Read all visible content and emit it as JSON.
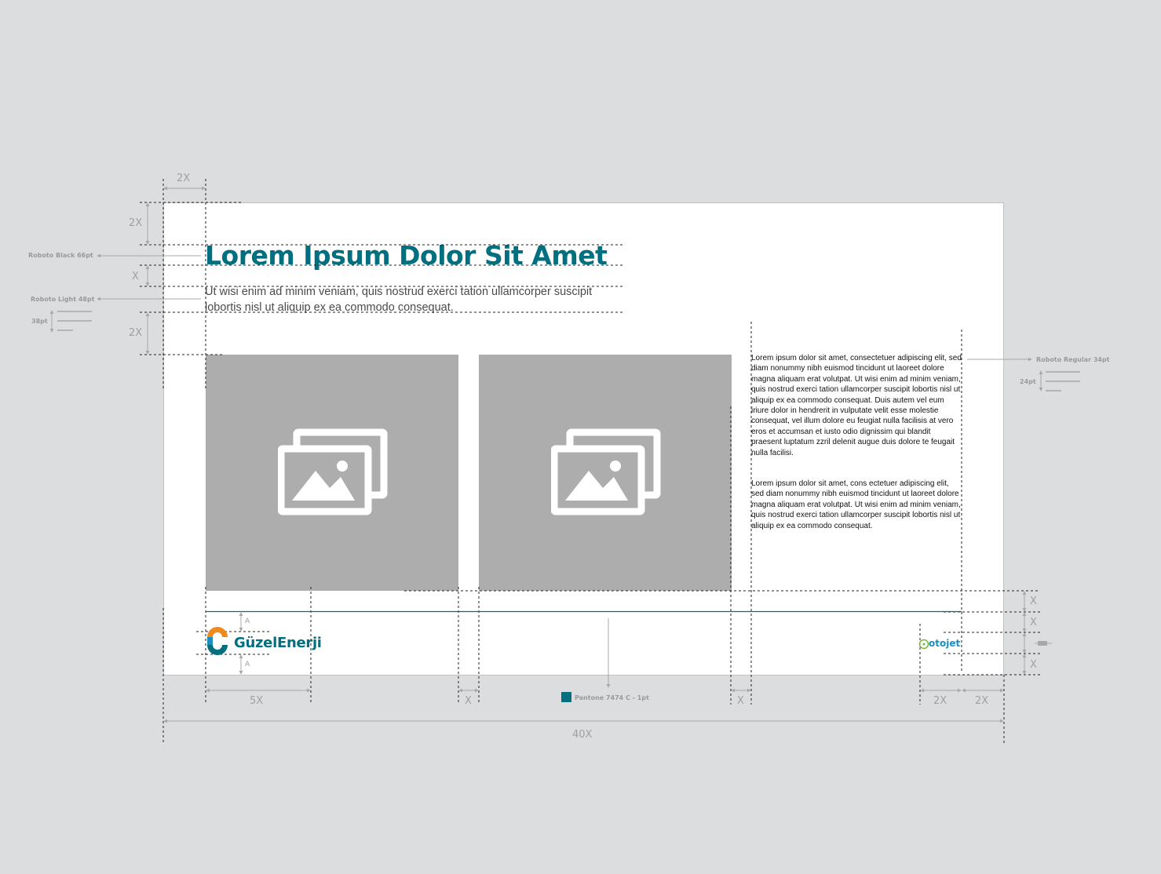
{
  "colors": {
    "brand": "#006f7f",
    "placeholder": "#adadad",
    "dimension": "#a0a0a0",
    "canvas": "#dcdddf",
    "otojet_green": "#7bb53b",
    "otojet_blue": "#1b8fc0",
    "guzel_orange": "#f08a1c"
  },
  "headline": "Lorem Ipsum Dolor Sit Amet",
  "subtitle": "Ut wisi enim ad minim veniam, quis nostrud exerci tation ullamcorper suscipit lobortis nisl ut aliquip ex ea commodo consequat.",
  "body_paragraphs": [
    "Lorem ipsum dolor sit amet, consectetuer adipiscing elit, sed diam nonummy nibh euismod tincidunt ut laoreet dolore magna aliquam erat volutpat. Ut wisi enim ad minim veniam, quis nostrud exerci tation ullamcorper suscipit lobortis nisl ut aliquip ex ea commodo consequat. Duis autem vel eum iriure dolor in hendrerit in vulputate velit esse molestie consequat, vel illum dolore eu feugiat nulla facilisis at vero eros et accumsan et iusto odio dignissim qui blandit praesent luptatum zzril delenit augue duis dolore te feugait nulla facilisi.",
    "Lorem ipsum dolor sit amet, cons ectetuer adipiscing elit, sed diam nonummy nibh euismod tincidunt ut laoreet dolore magna aliquam erat volutpat. Ut wisi enim ad minim veniam, quis nostrud exerci tation ullamcorper suscipit lobortis nisl ut aliquip ex ea commodo consequat."
  ],
  "annotations": {
    "headline_font": "Roboto Black 66pt",
    "subtitle_font": "Roboto Light 48pt",
    "subtitle_leading": "38pt",
    "body_font": "Roboto Regular 34pt",
    "body_leading": "24pt",
    "pantone": "Pantone 7474 C - 1pt"
  },
  "dimensions": {
    "top_left_width": "2X",
    "top_margin": "2X",
    "title_gap": "X",
    "subtitle_gap": "2X",
    "logo_width": "5X",
    "gutter_a": "X",
    "gutter_b": "X",
    "right_2x_a": "2X",
    "right_2x_b": "2X",
    "total_width": "40X",
    "right_x_1": "X",
    "right_x_2": "X",
    "right_x_3": "X",
    "logo_pad_top": "A",
    "logo_pad_bottom": "A"
  },
  "logos": {
    "left": "GüzelEnerji",
    "right": "otojet"
  },
  "icons": {
    "photo_placeholder": "image-gallery-icon",
    "guzel_mark": "guzel-enerji-logo-mark",
    "otojet_mark": "otojet-logo-mark"
  }
}
